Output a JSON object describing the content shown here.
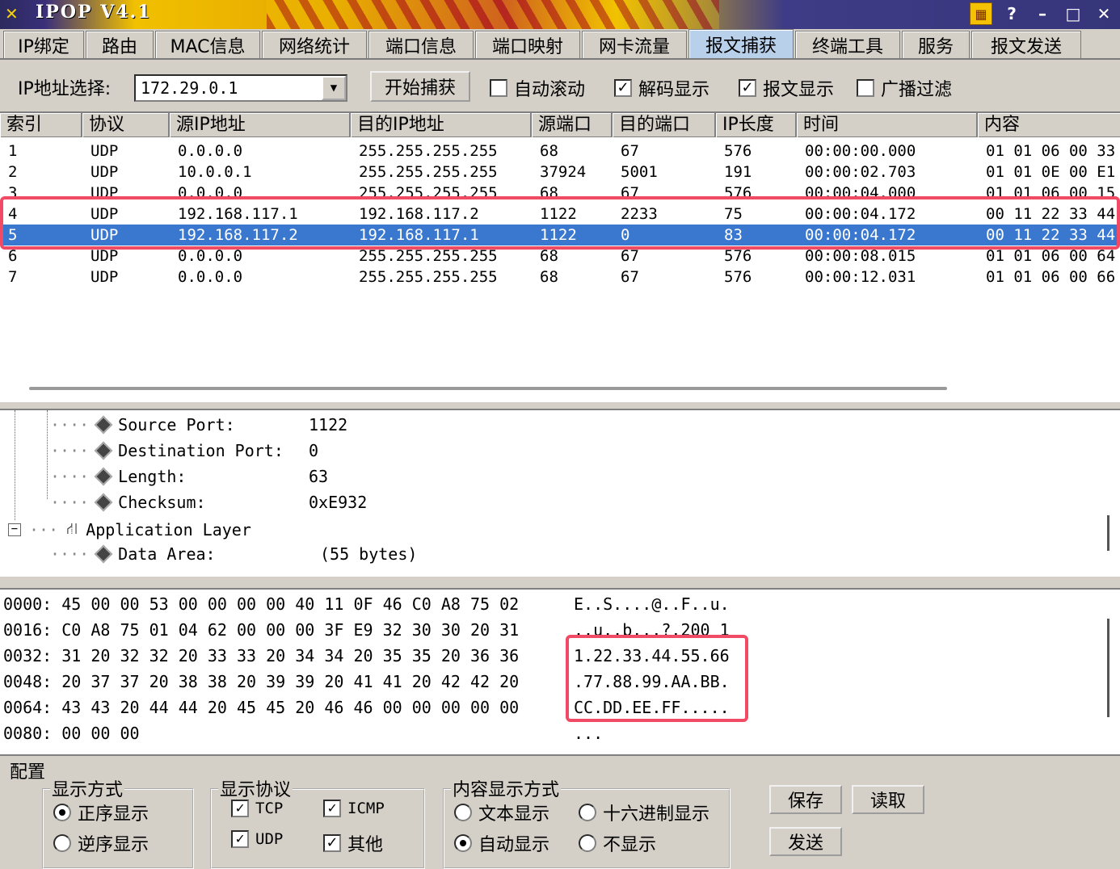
{
  "window": {
    "title": "IPOP V4.1"
  },
  "tabs": [
    {
      "label": "IP绑定"
    },
    {
      "label": "路由"
    },
    {
      "label": "MAC信息"
    },
    {
      "label": "网络统计"
    },
    {
      "label": "端口信息"
    },
    {
      "label": "端口映射"
    },
    {
      "label": "网卡流量"
    },
    {
      "label": "报文捕获"
    },
    {
      "label": "终端工具"
    },
    {
      "label": "服务"
    },
    {
      "label": "报文发送"
    }
  ],
  "active_tab": "报文捕获",
  "toolbar": {
    "ip_label": "IP地址选择:",
    "ip_value": "172.29.0.1",
    "start_capture": "开始捕获",
    "auto_scroll": "自动滚动",
    "auto_scroll_checked": false,
    "decode_display": "解码显示",
    "decode_display_checked": true,
    "packet_display": "报文显示",
    "packet_display_checked": true,
    "broadcast_filter": "广播过滤",
    "broadcast_filter_checked": false
  },
  "grid": {
    "columns": [
      "索引",
      "协议",
      "源IP地址",
      "目的IP地址",
      "源端口",
      "目的端口",
      "IP长度",
      "时间",
      "内容"
    ],
    "rows": [
      [
        "1",
        "UDP",
        "0.0.0.0",
        "255.255.255.255",
        "68",
        "67",
        "576",
        "00:00:00.000",
        "01 01 06 00 33"
      ],
      [
        "2",
        "UDP",
        "10.0.0.1",
        "255.255.255.255",
        "37924",
        "5001",
        "191",
        "00:00:02.703",
        "01 01 0E 00 E1"
      ],
      [
        "3",
        "UDP",
        "0.0.0.0",
        "255.255.255.255",
        "68",
        "67",
        "576",
        "00:00:04.000",
        "01 01 06 00 15"
      ],
      [
        "4",
        "UDP",
        "192.168.117.1",
        "192.168.117.2",
        "1122",
        "2233",
        "75",
        "00:00:04.172",
        "00 11 22 33 44"
      ],
      [
        "5",
        "UDP",
        "192.168.117.2",
        "192.168.117.1",
        "1122",
        "0",
        "83",
        "00:00:04.172",
        "00 11 22 33 44"
      ],
      [
        "6",
        "UDP",
        "0.0.0.0",
        "255.255.255.255",
        "68",
        "67",
        "576",
        "00:00:08.015",
        "01 01 06 00 64"
      ],
      [
        "7",
        "UDP",
        "0.0.0.0",
        "255.255.255.255",
        "68",
        "67",
        "576",
        "00:00:12.031",
        "01 01 06 00 66"
      ]
    ],
    "selected_index": "5"
  },
  "decode_tree": {
    "fields": [
      {
        "name": "Source Port:",
        "value": "1122"
      },
      {
        "name": "Destination Port:",
        "value": "0"
      },
      {
        "name": "Length:",
        "value": "63"
      },
      {
        "name": "Checksum:",
        "value": "0xE932"
      }
    ],
    "layer": "Application Layer",
    "data_area": {
      "name": "Data Area:",
      "value": "(55 bytes)"
    }
  },
  "hex_dump": [
    {
      "offset": "0000:",
      "hex": "45 00 00 53 00 00 00 00 40 11 0F 46 C0 A8 75 02",
      "ascii": "E..S....@..F..u."
    },
    {
      "offset": "0016:",
      "hex": "C0 A8 75 01 04 62 00 00 00 3F E9 32 30 30 20 31",
      "ascii": "..u..b...?.200 1"
    },
    {
      "offset": "0032:",
      "hex": "31 20 32 32 20 33 33 20 34 34 20 35 35 20 36 36",
      "ascii": "1.22.33.44.55.66"
    },
    {
      "offset": "0048:",
      "hex": "20 37 37 20 38 38 20 39 39 20 41 41 20 42 42 20",
      "ascii": ".77.88.99.AA.BB."
    },
    {
      "offset": "0064:",
      "hex": "43 43 20 44 44 20 45 45 20 46 46 00 00 00 00 00",
      "ascii": "CC.DD.EE.FF....."
    },
    {
      "offset": "0080:",
      "hex": "00 00 00",
      "ascii": "..."
    }
  ],
  "config": {
    "title": "配置",
    "display_mode": {
      "label": "显示方式",
      "forward": "正序显示",
      "reverse": "逆序显示",
      "selected": "正序显示"
    },
    "protocols": {
      "label": "显示协议",
      "tcp": "TCP",
      "icmp": "ICMP",
      "udp": "UDP",
      "other": "其他"
    },
    "content_mode": {
      "label": "内容显示方式",
      "text": "文本显示",
      "hex": "十六进制显示",
      "auto": "自动显示",
      "none": "不显示",
      "selected": "自动显示"
    },
    "save": "保存",
    "read": "读取",
    "send": "发送"
  }
}
